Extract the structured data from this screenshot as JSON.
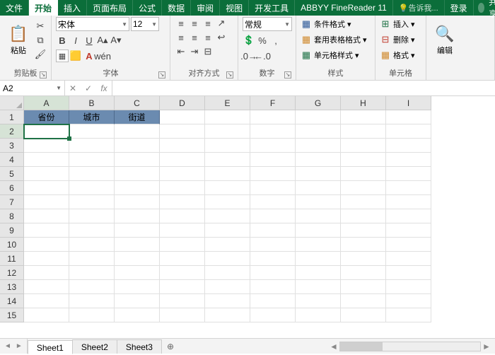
{
  "tabs": {
    "file": "文件",
    "home": "开始",
    "insert": "插入",
    "layout": "页面布局",
    "formula": "公式",
    "data": "数据",
    "review": "审阅",
    "view": "视图",
    "dev": "开发工具",
    "abbyy": "ABBYY FineReader 11",
    "tell_me": "告诉我...",
    "login": "登录",
    "share": "共享"
  },
  "ribbon": {
    "clipboard": {
      "paste": "粘贴",
      "label": "剪贴板"
    },
    "font": {
      "name": "宋体",
      "size": "12",
      "label": "字体"
    },
    "align": {
      "label": "对齐方式"
    },
    "number": {
      "format": "常规",
      "label": "数字"
    },
    "styles": {
      "cond": "条件格式",
      "tbl": "套用表格格式",
      "cell": "单元格样式",
      "label": "样式"
    },
    "cells": {
      "ins": "插入",
      "del": "删除",
      "fmt": "格式",
      "label": "单元格"
    },
    "editing": {
      "label": "编辑"
    }
  },
  "formula_bar": {
    "cell_ref": "A2",
    "fx": "fx",
    "value": ""
  },
  "grid": {
    "cols": [
      "A",
      "B",
      "C",
      "D",
      "E",
      "F",
      "G",
      "H",
      "I"
    ],
    "rows": [
      "1",
      "2",
      "3",
      "4",
      "5",
      "6",
      "7",
      "8",
      "9",
      "10",
      "11",
      "12",
      "13",
      "14",
      "15"
    ],
    "headers": {
      "A1": "省份",
      "B1": "城市",
      "C1": "街道"
    },
    "active": "A2"
  },
  "sheets": {
    "s1": "Sheet1",
    "s2": "Sheet2",
    "s3": "Sheet3",
    "add": "⊕"
  }
}
